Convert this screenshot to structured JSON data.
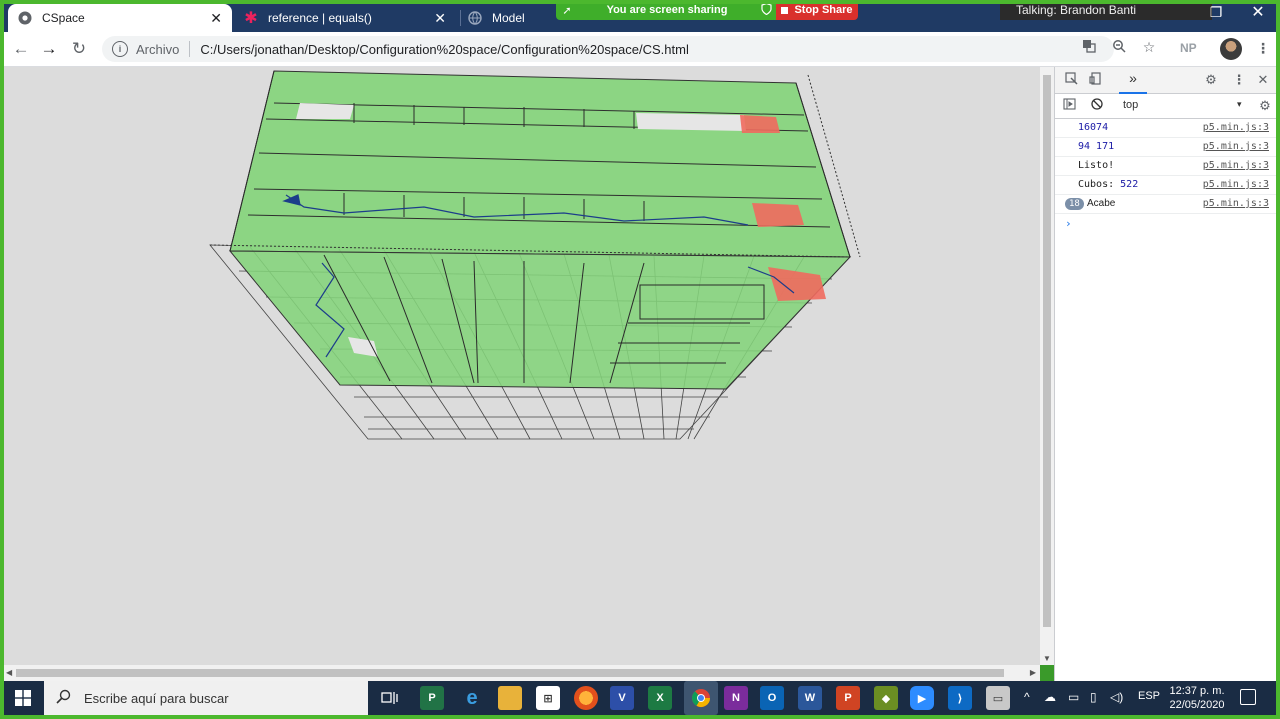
{
  "tabs": [
    {
      "title": "CSpace",
      "icon": "chrome-icon",
      "active": true
    },
    {
      "title": "reference | equals()",
      "icon": "p5-star-icon",
      "active": false
    },
    {
      "title": "Model",
      "icon": "globe-icon",
      "active": false
    }
  ],
  "screen_share": {
    "status": "You are screen sharing",
    "stop_label": "Stop Share",
    "talking": "Talking: Brandon Banti"
  },
  "address_bar": {
    "security_label": "Archivo",
    "url": "C:/Users/jonathan/Desktop/Configuration%20space/Configuration%20space/CS.html"
  },
  "profile": {
    "initials": "NP"
  },
  "devtools": {
    "context": "top",
    "logs": [
      {
        "text": "16074",
        "source": "p5.min.js:3"
      },
      {
        "text": "94 171",
        "source": "p5.min.js:3"
      },
      {
        "text": "Listo!",
        "source": "p5.min.js:3"
      },
      {
        "label": "Cubos:",
        "value": "522",
        "source": "p5.min.js:3"
      },
      {
        "count": "18",
        "text": "Acabe",
        "source": "p5.min.js:3"
      }
    ],
    "prompt": "›"
  },
  "taskbar": {
    "search_placeholder": "Escribe aquí para buscar",
    "language": "ESP",
    "time": "12:37 p. m.",
    "date": "22/05/2020"
  },
  "colors": {
    "accent": "#4cb82e",
    "green_volume": "#82d77c",
    "red_block": "#f06a5e",
    "stop_red": "#d9302c"
  }
}
